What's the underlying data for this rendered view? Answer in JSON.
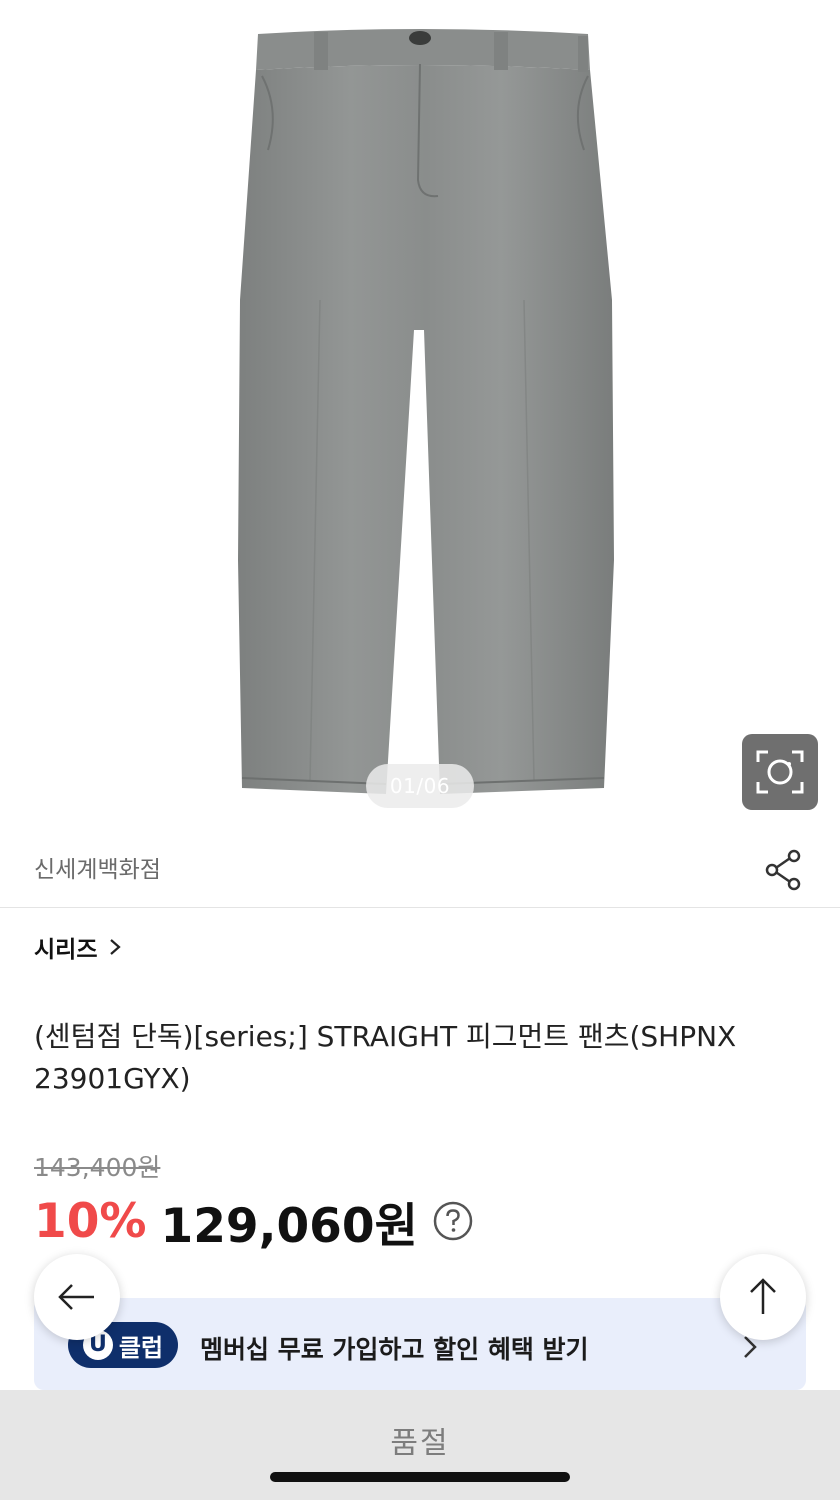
{
  "gallery": {
    "counter": "01/06",
    "image_subject": "grey straight pants"
  },
  "seller": {
    "name": "신세계백화점"
  },
  "brand": {
    "name": "시리즈"
  },
  "product": {
    "title": "(센텀점 단독)[series;] STRAIGHT 피그먼트 팬츠(SHPNX 23901GYX)"
  },
  "price": {
    "original": "143,400원",
    "discount": "10%",
    "sale": "129,060원"
  },
  "promo": {
    "badge_letter": "U",
    "badge_text": "클럽",
    "text": "멤버십 무료 가입하고 할인 혜택 받기"
  },
  "bottom": {
    "status_label": "품절"
  },
  "colors": {
    "discount_red": "#f04a4a",
    "uclub_navy": "#0f2f6b",
    "banner_bg": "#e9eefb",
    "pants_grey": "#8c8f8e"
  },
  "icons": {
    "lens": "lens-search-icon",
    "share": "share-icon",
    "brand_chevron": "chevron-right-icon",
    "help": "question-circle-icon",
    "back": "arrow-left-icon",
    "top": "arrow-up-icon"
  }
}
